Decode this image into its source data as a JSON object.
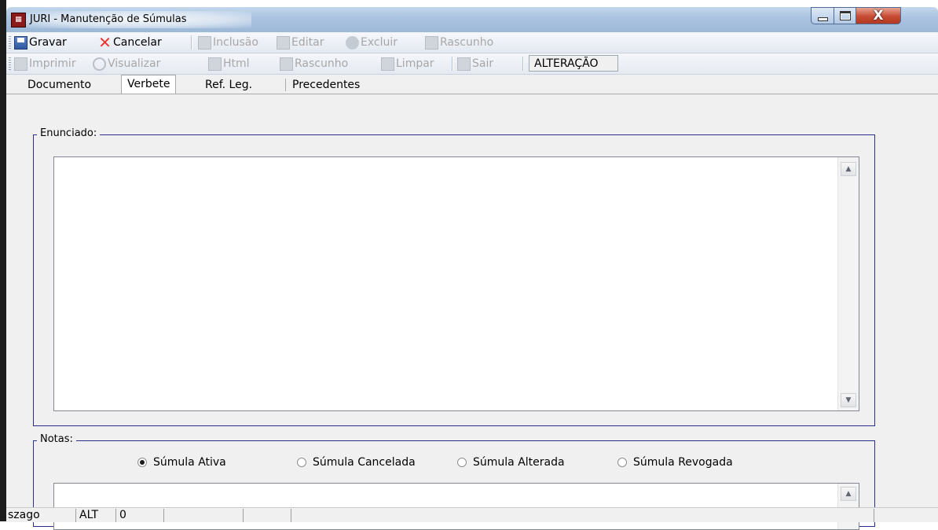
{
  "window": {
    "title": "JURI - Manutenção de Súmulas",
    "icon": "app-calendar-icon",
    "controls": {
      "minimize": "minimize",
      "maximize": "maximize",
      "close": "X"
    }
  },
  "toolbar1": {
    "items": [
      {
        "label": "Gravar",
        "icon": "save-icon",
        "enabled": true
      },
      {
        "label": "Cancelar",
        "icon": "cancel-x-icon",
        "enabled": true
      },
      {
        "label": "Inclusão",
        "icon": "new-document-icon",
        "enabled": false
      },
      {
        "label": "Editar",
        "icon": "edit-icon",
        "enabled": false
      },
      {
        "label": "Excluir",
        "icon": "delete-icon",
        "enabled": false
      },
      {
        "label": "Rascunho",
        "icon": "draft-icon",
        "enabled": false
      }
    ]
  },
  "toolbar2": {
    "items": [
      {
        "label": "Imprimir",
        "icon": "printer-icon",
        "enabled": false
      },
      {
        "label": "Visualizar",
        "icon": "magnifier-icon",
        "enabled": false
      },
      {
        "label": "Html",
        "icon": "html-icon",
        "enabled": false
      },
      {
        "label": "Rascunho",
        "icon": "draft-icon",
        "enabled": false
      },
      {
        "label": "Limpar",
        "icon": "clear-icon",
        "enabled": false
      },
      {
        "label": "Sair",
        "icon": "exit-icon",
        "enabled": false
      }
    ],
    "mode": "ALTERAÇÃO"
  },
  "tabs": [
    {
      "label": "Documento",
      "active": false
    },
    {
      "label": "Verbete",
      "active": true
    },
    {
      "label": "Ref. Leg.",
      "active": false
    },
    {
      "label": "Precedentes",
      "active": false
    }
  ],
  "enunciado": {
    "label": "Enunciado:",
    "value": ""
  },
  "notas": {
    "label": "Notas:",
    "options": [
      {
        "label": "Súmula Ativa",
        "selected": true
      },
      {
        "label": "Súmula Cancelada",
        "selected": false
      },
      {
        "label": "Súmula Alterada",
        "selected": false
      },
      {
        "label": "Súmula Revogada",
        "selected": false
      }
    ],
    "value": ""
  },
  "statusbar": {
    "panels": [
      "szago",
      "ALT",
      "0",
      "",
      "",
      "",
      ""
    ]
  },
  "colors": {
    "group_border": "#2b2f8c",
    "disabled_text": "#a7a7a7",
    "titlebar": "#a9c3e0"
  }
}
